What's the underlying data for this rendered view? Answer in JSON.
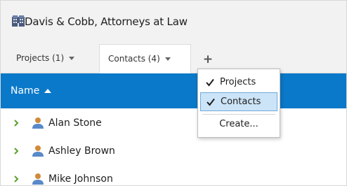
{
  "header": {
    "title": "Davis & Cobb, Attorneys at Law",
    "icon": "buildings-icon"
  },
  "tabs": [
    {
      "label": "Projects (1)",
      "selected": false
    },
    {
      "label": "Contacts (4)",
      "selected": true
    }
  ],
  "add_tab_label": "+",
  "grid": {
    "column_name": "Name",
    "sort": "ascending",
    "rows": [
      {
        "name": "Alan Stone"
      },
      {
        "name": "Ashley Brown"
      },
      {
        "name": "Mike Johnson"
      }
    ]
  },
  "tab_menu": {
    "items": [
      {
        "label": "Projects",
        "checked": true
      },
      {
        "label": "Contacts",
        "checked": true,
        "highlighted": true
      },
      {
        "label": "Create..."
      }
    ]
  },
  "colors": {
    "accent": "#0b79c9",
    "header_bg": "#f2f2f2",
    "menu_highlight": "#cce4f7",
    "expander_green": "#5aa02c",
    "person_icon": "#d08a3a"
  }
}
